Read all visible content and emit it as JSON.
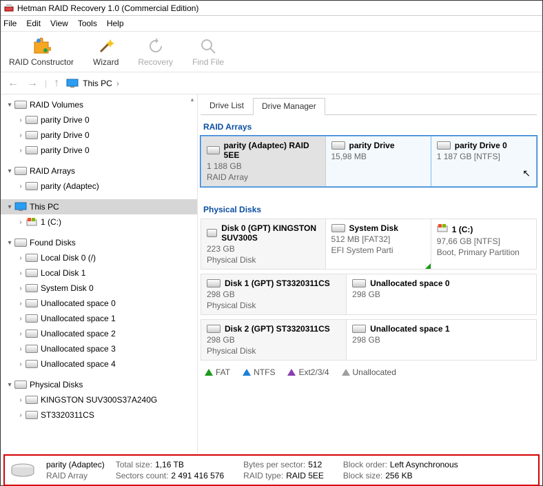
{
  "title": "Hetman RAID Recovery 1.0 (Commercial Edition)",
  "menu": [
    "File",
    "Edit",
    "View",
    "Tools",
    "Help"
  ],
  "toolbar": [
    {
      "label": "RAID Constructor",
      "icon": "puzzle",
      "enabled": true
    },
    {
      "label": "Wizard",
      "icon": "wand",
      "enabled": true
    },
    {
      "label": "Recovery",
      "icon": "recovery",
      "enabled": false
    },
    {
      "label": "Find File",
      "icon": "search",
      "enabled": false
    }
  ],
  "breadcrumb": {
    "root": "This PC"
  },
  "sidebar": {
    "groups": [
      {
        "label": "RAID Volumes",
        "expanded": true,
        "children": [
          {
            "label": "parity Drive 0"
          },
          {
            "label": "parity Drive 0"
          },
          {
            "label": "parity Drive 0"
          }
        ]
      },
      {
        "label": "RAID Arrays",
        "expanded": true,
        "children": [
          {
            "label": "parity (Adaptec)"
          }
        ]
      },
      {
        "label": "This PC",
        "expanded": true,
        "selected": true,
        "icon": "monitor",
        "children": [
          {
            "label": "1 (C:)",
            "icon": "win-drive"
          }
        ]
      },
      {
        "label": "Found Disks",
        "expanded": true,
        "children": [
          {
            "label": "Local Disk 0 (/)"
          },
          {
            "label": "Local Disk 1"
          },
          {
            "label": "System Disk 0"
          },
          {
            "label": "Unallocated space 0"
          },
          {
            "label": "Unallocated space 1"
          },
          {
            "label": "Unallocated space 2"
          },
          {
            "label": "Unallocated space 3"
          },
          {
            "label": "Unallocated space 4"
          }
        ]
      },
      {
        "label": "Physical Disks",
        "expanded": true,
        "children": [
          {
            "label": "KINGSTON SUV300S37A240G"
          },
          {
            "label": "ST3320311CS"
          }
        ]
      }
    ]
  },
  "tabs": [
    {
      "label": "Drive List",
      "active": false
    },
    {
      "label": "Drive Manager",
      "active": true
    }
  ],
  "sections": {
    "raid_title": "RAID Arrays",
    "raid_cards": [
      {
        "title": "parity (Adaptec) RAID 5EE",
        "sub1": "1 188 GB",
        "sub2": "RAID Array",
        "wide": true
      },
      {
        "title": "parity Drive",
        "sub1": "15,98 MB"
      },
      {
        "title": "parity Drive 0",
        "sub1": "1 187 GB [NTFS]"
      }
    ],
    "phys_title": "Physical Disks",
    "disks": [
      {
        "main": {
          "title": "Disk 0 (GPT) KINGSTON SUV300S",
          "sub1": "223 GB",
          "sub2": "Physical Disk"
        },
        "parts": [
          {
            "title": "System Disk",
            "sub1": "512 MB [FAT32]",
            "sub2": "EFI System Parti",
            "corner": true
          },
          {
            "title": "1 (C:)",
            "icon": "win-drive",
            "sub1": "97,66 GB [NTFS]",
            "sub2": "Boot, Primary Partition"
          }
        ]
      },
      {
        "main": {
          "title": "Disk 1 (GPT) ST3320311CS",
          "sub1": "298 GB",
          "sub2": "Physical Disk"
        },
        "parts": [
          {
            "title": "Unallocated space 0",
            "sub1": "298 GB"
          }
        ]
      },
      {
        "main": {
          "title": "Disk 2 (GPT) ST3320311CS",
          "sub1": "298 GB",
          "sub2": "Physical Disk"
        },
        "parts": [
          {
            "title": "Unallocated space 1",
            "sub1": "298 GB"
          }
        ]
      }
    ]
  },
  "legend": [
    {
      "label": "FAT",
      "color": "#1a9b1a"
    },
    {
      "label": "NTFS",
      "color": "#1e7fd6"
    },
    {
      "label": "Ext2/3/4",
      "color": "#8a3fae"
    },
    {
      "label": "Unallocated",
      "color": "#9e9e9e"
    }
  ],
  "status": {
    "name": "parity (Adaptec)",
    "type": "RAID Array",
    "cols": [
      [
        {
          "k": "Total size:",
          "v": "1,16 TB"
        },
        {
          "k": "Sectors count:",
          "v": "2 491 416 576"
        }
      ],
      [
        {
          "k": "Bytes per sector:",
          "v": "512"
        },
        {
          "k": "RAID type:",
          "v": "RAID 5EE"
        }
      ],
      [
        {
          "k": "Block order:",
          "v": "Left Asynchronous"
        },
        {
          "k": "Block size:",
          "v": "256 KB"
        }
      ]
    ]
  }
}
